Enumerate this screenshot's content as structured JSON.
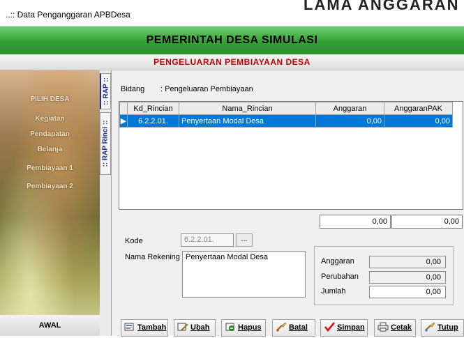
{
  "window": {
    "title": "..:: Data Penganggaran APBDesa",
    "ghost_text": "LAMA ANGGARAN"
  },
  "banner": {
    "title": "PEMERINTAH DESA SIMULASI",
    "subtitle": "PENGELUARAN PEMBIAYAAN DESA"
  },
  "colors": {
    "banner_green": "#34a034",
    "subtitle_red": "#c00000",
    "selection_blue": "#0078d7",
    "tab_text_blue": "#1f2f8f"
  },
  "sidebar": {
    "heading": "PILIH DESA",
    "items": [
      {
        "label": "Kegiatan"
      },
      {
        "label": "Pendapatan"
      },
      {
        "label": "Belanja"
      },
      {
        "label": "Pembiayaan 1"
      },
      {
        "label": "Pembiayaan 2"
      }
    ],
    "footer": "AWAL"
  },
  "vertical_tabs": [
    {
      "label": ":: RAP ::",
      "active": true
    },
    {
      "label": ":: RAP Rinci ::",
      "active": false
    }
  ],
  "bidang": {
    "label": "Bidang",
    "value": ": Pengeluaran Pembiayaan"
  },
  "grid": {
    "columns": [
      "Kd_Rincian",
      "Nama_Rincian",
      "Anggaran",
      "AnggaranPAK"
    ],
    "rows": [
      {
        "indicator": "▶",
        "kd": "6.2.2.01.",
        "nama": "Penyertaan Modal Desa",
        "anggaran": "0,00",
        "pak": "0,00",
        "selected": true
      }
    ],
    "total_anggaran": "0,00",
    "total_pak": "0,00"
  },
  "form": {
    "kode_label": "Kode",
    "kode_value": "6.2.2.01.",
    "kode_button": "...",
    "nama_label": "Nama Rekening",
    "nama_value": "Penyertaan Modal Desa",
    "anggaran_label": "Anggaran",
    "anggaran_value": "0,00",
    "perubahan_label": "Perubahan",
    "perubahan_value": "0,00",
    "jumlah_label": "Jumlah",
    "jumlah_value": "0,00"
  },
  "toolbar": {
    "tambah": "Tambah",
    "ubah": "Ubah",
    "hapus": "Hapus",
    "batal": "Batal",
    "simpan": "Simpan",
    "cetak": "Cetak",
    "tutup": "Tutup"
  }
}
